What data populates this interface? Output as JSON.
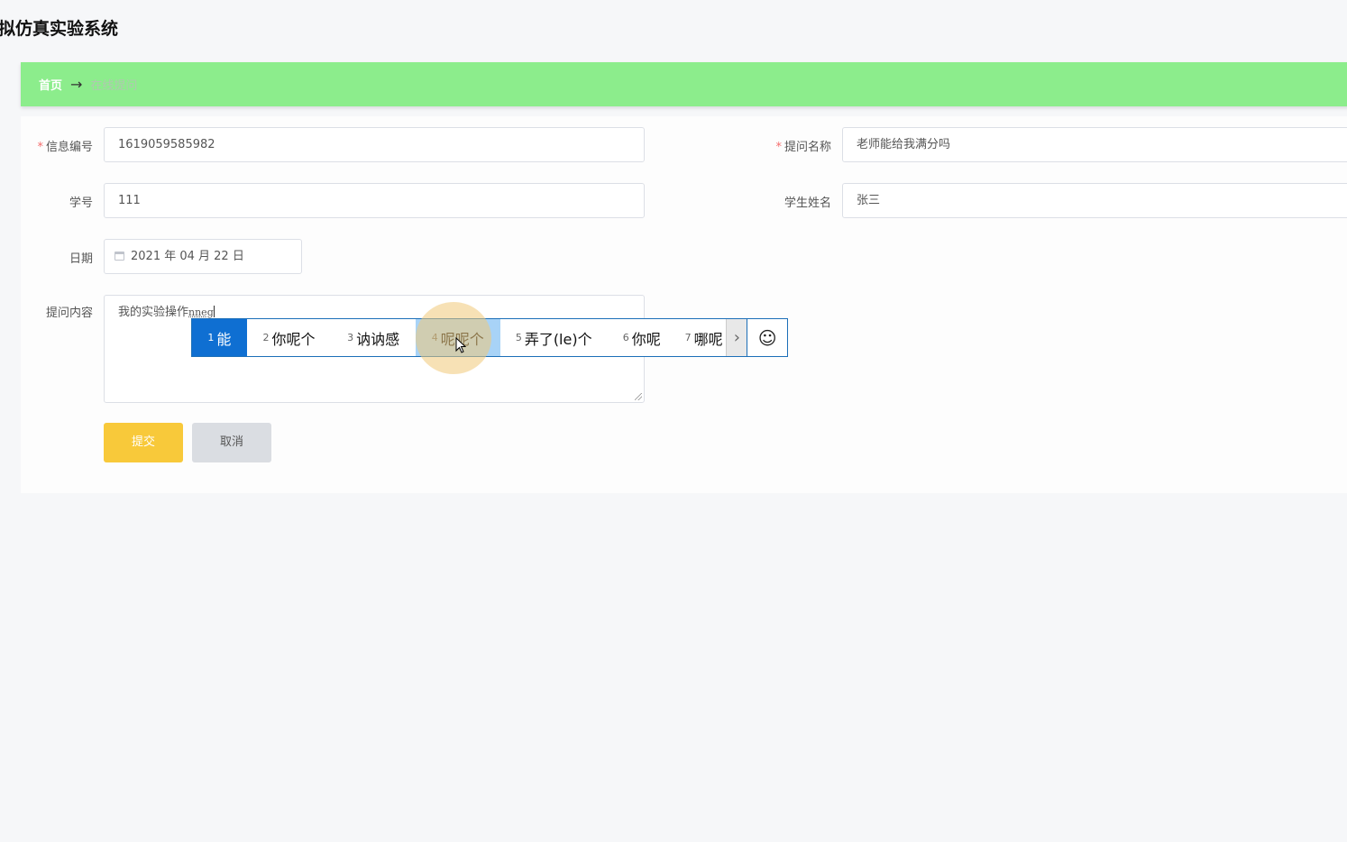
{
  "app": {
    "title": "拟仿真实验系统"
  },
  "breadcrumb": {
    "home": "首页",
    "separator": "→",
    "current": "在线提问"
  },
  "form": {
    "info_id": {
      "label": "信息编号",
      "value": "1619059585982"
    },
    "question_name": {
      "label": "提问名称",
      "value": "老师能给我满分吗"
    },
    "student_no": {
      "label": "学号",
      "value": "111"
    },
    "student_name": {
      "label": "学生姓名",
      "value": "张三"
    },
    "date": {
      "label": "日期",
      "value": "2021 年 04 月 22 日"
    },
    "content": {
      "label": "提问内容",
      "value": "我的实验操作",
      "composing": "nneg"
    },
    "required_mark": "*",
    "submit_label": "提交",
    "cancel_label": "取消"
  },
  "ime": {
    "candidates": [
      {
        "num": "1",
        "text": "能"
      },
      {
        "num": "2",
        "text": "你呢个"
      },
      {
        "num": "3",
        "text": "讷讷感"
      },
      {
        "num": "4",
        "text": "呢呢个"
      },
      {
        "num": "5",
        "text": "弄了(le)个"
      },
      {
        "num": "6",
        "text": "你呢"
      },
      {
        "num": "7",
        "text": "哪呢"
      }
    ],
    "next_symbol": "›",
    "emoji_symbol": "☺"
  },
  "colors": {
    "breadcrumb_bg": "#8ced8c",
    "submit_bg": "#f8c93a",
    "cancel_bg": "#dadde2",
    "ime_selected": "#0f6fd2",
    "required": "#f56c6c"
  }
}
